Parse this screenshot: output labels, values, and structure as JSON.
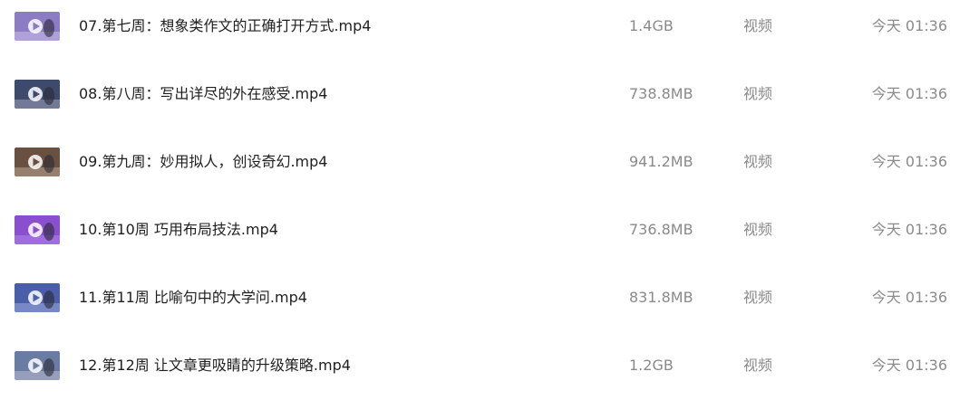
{
  "files": [
    {
      "name": "07.第七周：想象类作文的正确打开方式.mp4",
      "size": "1.4GB",
      "type": "视频",
      "modified": "今天 01:36",
      "thumb": {
        "icon": "video-thumbnail-icon",
        "bg": "#8c7cc4",
        "accent": "#f0e6ff"
      }
    },
    {
      "name": "08.第八周：写出详尽的外在感受.mp4",
      "size": "738.8MB",
      "type": "视频",
      "modified": "今天 01:36",
      "thumb": {
        "icon": "video-thumbnail-icon",
        "bg": "#3d4a6b",
        "accent": "#d9d3ee"
      }
    },
    {
      "name": "09.第九周：妙用拟人，创设奇幻.mp4",
      "size": "941.2MB",
      "type": "视频",
      "modified": "今天 01:36",
      "thumb": {
        "icon": "video-thumbnail-icon",
        "bg": "#6a5040",
        "accent": "#e9d6c3"
      }
    },
    {
      "name": "10.第10周 巧用布局技法.mp4",
      "size": "736.8MB",
      "type": "视频",
      "modified": "今天 01:36",
      "thumb": {
        "icon": "video-thumbnail-icon",
        "bg": "#8a4fcf",
        "accent": "#c9a6ff"
      }
    },
    {
      "name": "11.第11周 比喻句中的大学问.mp4",
      "size": "831.8MB",
      "type": "视频",
      "modified": "今天 01:36",
      "thumb": {
        "icon": "video-thumbnail-icon",
        "bg": "#4a5fa8",
        "accent": "#cfd8ff"
      }
    },
    {
      "name": "12.第12周 让文章更吸睛的升级策略.mp4",
      "size": "1.2GB",
      "type": "视频",
      "modified": "今天 01:36",
      "thumb": {
        "icon": "video-thumbnail-icon",
        "bg": "#6b7ca3",
        "accent": "#e7e0ee"
      }
    }
  ]
}
